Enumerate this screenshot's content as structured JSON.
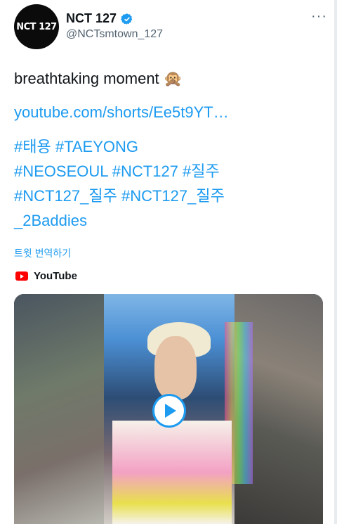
{
  "header": {
    "avatar_text": "NCT 127",
    "display_name": "NCT 127",
    "handle": "@NCTsmtown_127",
    "more": "···"
  },
  "tweet": {
    "text": "breathtaking moment 🙊",
    "link": "youtube.com/shorts/Ee5t9YT…",
    "hashtag_lines": [
      "#태용 #TAEYONG",
      "#NEOSEOUL #NCT127 #질주",
      "#NCT127_질주 #NCT127_질주",
      "_2Baddies"
    ],
    "translate": "트윗 번역하기"
  },
  "card": {
    "source": "YouTube"
  },
  "colors": {
    "link": "#1d9bf0",
    "verified": "#1d9bf0",
    "youtube_red": "#ff0000"
  }
}
